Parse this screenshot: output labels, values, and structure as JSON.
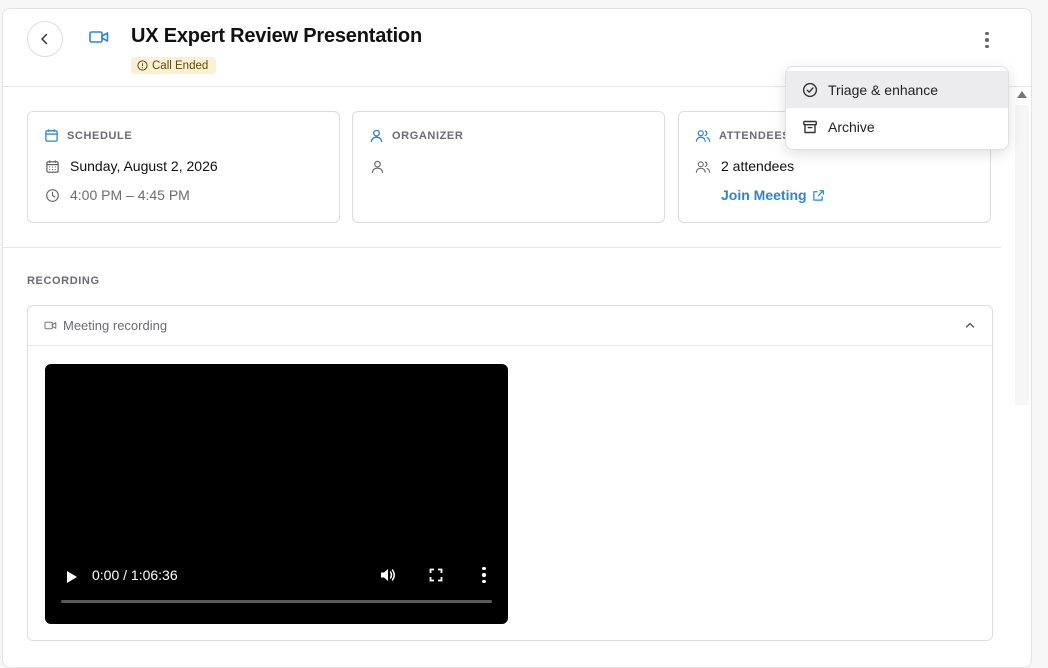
{
  "header": {
    "title": "UX Expert Review Presentation",
    "status_badge": "Call Ended"
  },
  "cards": {
    "schedule": {
      "heading": "SCHEDULE",
      "date": "Sunday, August 2, 2026",
      "time": "4:00 PM – 4:45 PM"
    },
    "organizer": {
      "heading": "ORGANIZER",
      "name": ""
    },
    "attendees": {
      "heading": "ATTENDEES",
      "count_text": "2 attendees",
      "join_link": "Join Meeting"
    }
  },
  "recording": {
    "section_label": "RECORDING",
    "panel_title": "Meeting recording",
    "player": {
      "time_display": "0:00 / 1:06:36",
      "progress": 0
    }
  },
  "menu": {
    "items": [
      {
        "label": "Triage & enhance",
        "icon": "check-circle-icon",
        "highlighted": true
      },
      {
        "label": "Archive",
        "icon": "archive-icon",
        "highlighted": false
      }
    ]
  },
  "colors": {
    "accent": "#2f86c9",
    "badge_bg": "#fbf1d2",
    "menu_highlight": "#ececee"
  }
}
